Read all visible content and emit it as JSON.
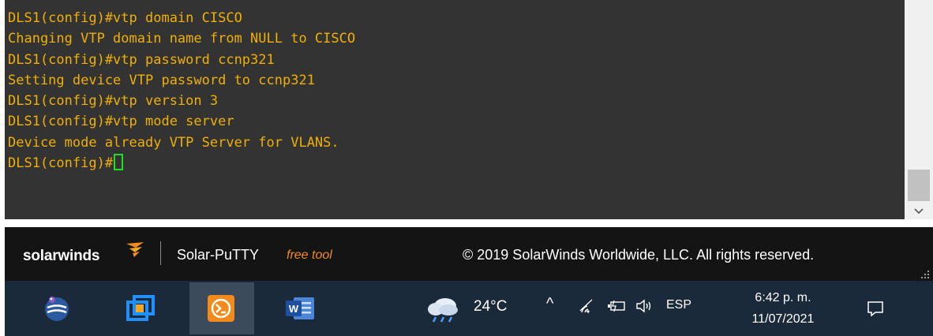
{
  "terminal": {
    "lines": [
      "DLS1(config)#vtp domain CISCO",
      "Changing VTP domain name from NULL to CISCO",
      "DLS1(config)#vtp password ccnp321",
      "Setting device VTP password to ccnp321",
      "DLS1(config)#vtp version 3",
      "DLS1(config)#vtp mode server",
      "Device mode already VTP Server for VLANS.",
      "DLS1(config)#"
    ],
    "text_color": "#f0b000",
    "cursor_color": "#22dd22",
    "background": "#333333"
  },
  "brand_bar": {
    "logo_text": "solarwinds",
    "app_name": "Solar-PuTTY",
    "app_tag": "free tool",
    "copyright": "© 2019 SolarWinds Worldwide, LLC. All rights reserved.",
    "accent_color": "#f28a1c"
  },
  "taskbar": {
    "apps": [
      {
        "name": "eclipse-icon"
      },
      {
        "name": "virtualbox-icon"
      },
      {
        "name": "solar-putty-icon",
        "active": true
      },
      {
        "name": "word-icon"
      }
    ],
    "weather": {
      "temperature": "24°C",
      "icon": "cloud-rain-icon"
    },
    "tray": {
      "chevron": "^",
      "language": "ESP"
    },
    "clock": {
      "time": "6:42 p. m.",
      "date": "11/07/2021"
    }
  }
}
